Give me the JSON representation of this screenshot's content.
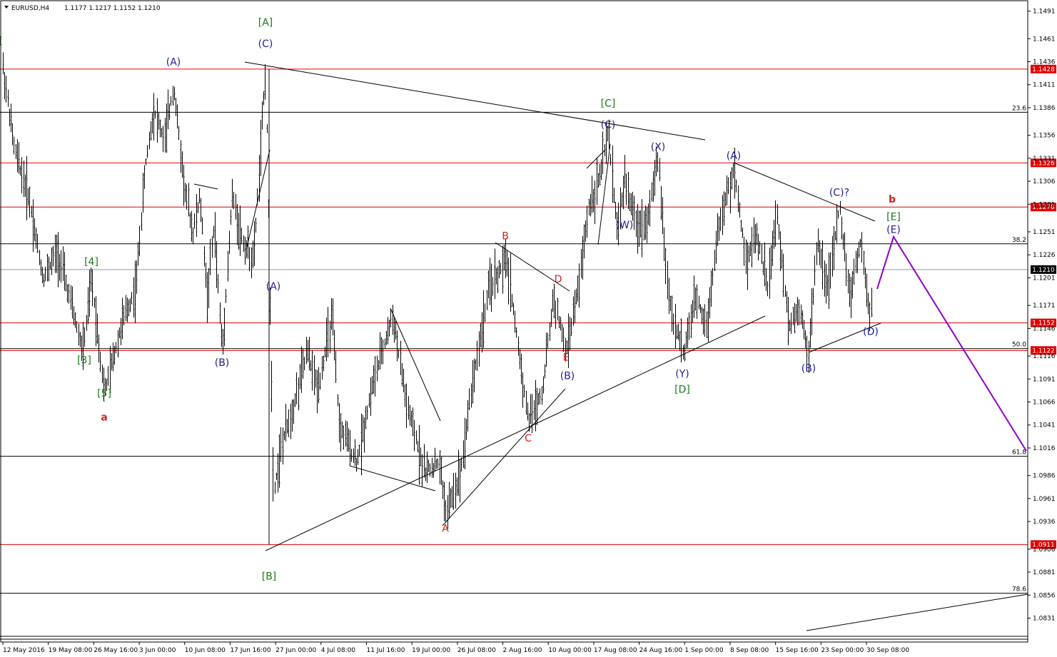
{
  "window": {
    "symbol": "EURUSD,H4",
    "ohlc": "1.1177 1.1217 1.1152 1.1210"
  },
  "colors": {
    "background": "#ffffff",
    "bars": "#000000",
    "resistance": "#e00000",
    "fibo": "#000000",
    "blue_label": "#1f1f8f",
    "green_label": "#1a7a1a",
    "red_label": "#d42020",
    "projection": "#8b00c8",
    "current_price_line": "#7a9cc0"
  },
  "chart_data": {
    "type": "candlestick",
    "instrument": "EURUSD",
    "timeframe": "H4",
    "last_bar": {
      "open": 1.1177,
      "high": 1.1217,
      "low": 1.1152,
      "close": 1.121
    },
    "current_price": "1.1210",
    "ylim": [
      1.0805,
      1.15
    ],
    "price_ticks": [
      "1.1491",
      "1.1461",
      "1.1436",
      "1.1411",
      "1.1386",
      "1.1356",
      "1.1331",
      "1.1306",
      "1.1281",
      "1.1251",
      "1.1226",
      "1.1201",
      "1.1171",
      "1.1146",
      "1.1116",
      "1.1091",
      "1.1066",
      "1.1041",
      "1.1016",
      "1.0986",
      "1.0961",
      "1.0936",
      "1.0906",
      "1.0881",
      "1.0856",
      "1.0831"
    ],
    "time_ticks": [
      "12 May 2016",
      "19 May 08:00",
      "26 May 16:00",
      "3 Jun 00:00",
      "10 Jun 08:00",
      "17 Jun 16:00",
      "27 Jun 00:00",
      "4 Jul 08:00",
      "11 Jul 16:00",
      "19 Jul 00:00",
      "26 Jul 08:00",
      "2 Aug 16:00",
      "10 Aug 00:00",
      "17 Aug 08:00",
      "24 Aug 16:00",
      "1 Sep 00:00",
      "8 Sep 08:00",
      "15 Sep 16:00",
      "23 Sep 00:00",
      "30 Sep 08:00"
    ],
    "horizontal_levels": [
      {
        "label": "1.1428",
        "price": 1.1428,
        "kind": "red"
      },
      {
        "label": "1.1326",
        "price": 1.1326,
        "kind": "red"
      },
      {
        "label": "1.1278",
        "price": 1.1278,
        "kind": "red"
      },
      {
        "label": "1.1152",
        "price": 1.1152,
        "kind": "red"
      },
      {
        "label": "1.1122",
        "price": 1.1122,
        "kind": "red"
      },
      {
        "label": "1.0911",
        "price": 1.0911,
        "kind": "red"
      }
    ],
    "fibo_levels": [
      {
        "label": "23.6",
        "price": 1.1381
      },
      {
        "label": "38.2",
        "price": 1.1238
      },
      {
        "label": "50.0",
        "price": 1.1124
      },
      {
        "label": "61.8",
        "price": 1.1007
      },
      {
        "label": "78.6",
        "price": 1.0858
      }
    ],
    "wave_labels": [
      {
        "text": "[",
        "price": 1.1455,
        "time": 1,
        "color": "green"
      },
      {
        "text": "[A]",
        "price": 1.1475,
        "time": 372,
        "color": "green"
      },
      {
        "text": "(A)",
        "price": 1.1432,
        "time": 243,
        "color": "blue"
      },
      {
        "text": "(C)",
        "price": 1.1452,
        "time": 372,
        "color": "blue"
      },
      {
        "text": "[4]",
        "price": 1.1215,
        "time": 128,
        "color": "green"
      },
      {
        "text": "[3]",
        "price": 1.1108,
        "time": 118,
        "color": "green"
      },
      {
        "text": "[5]",
        "price": 1.1072,
        "time": 146,
        "color": "green"
      },
      {
        "text": "a",
        "price": 1.1046,
        "time": 146,
        "color": "red"
      },
      {
        "text": "(B)",
        "price": 1.1105,
        "time": 311,
        "color": "blue"
      },
      {
        "text": "(A)",
        "price": 1.1188,
        "time": 383,
        "color": "blue"
      },
      {
        "text": "[B]",
        "price": 1.0873,
        "time": 377,
        "color": "green"
      },
      {
        "text": "B",
        "price": 1.1243,
        "time": 708,
        "color": "red"
      },
      {
        "text": "D",
        "price": 1.1196,
        "time": 782,
        "color": "red"
      },
      {
        "text": "E",
        "price": 1.1111,
        "time": 793,
        "color": "red"
      },
      {
        "text": "(B)",
        "price": 1.1091,
        "time": 795,
        "color": "blue"
      },
      {
        "text": "C",
        "price": 1.1023,
        "time": 740,
        "color": "red"
      },
      {
        "text": "A",
        "price": 1.0925,
        "time": 624,
        "color": "red"
      },
      {
        "text": "[C]",
        "price": 1.1387,
        "time": 852,
        "color": "green"
      },
      {
        "text": "(C)",
        "price": 1.1364,
        "time": 852,
        "color": "blue"
      },
      {
        "text": "(X)",
        "price": 1.134,
        "time": 922,
        "color": "blue"
      },
      {
        "text": "(W)",
        "price": 1.1255,
        "time": 875,
        "color": "blue"
      },
      {
        "text": "(Y)",
        "price": 1.1093,
        "time": 956,
        "color": "blue"
      },
      {
        "text": "[D]",
        "price": 1.1076,
        "time": 956,
        "color": "green"
      },
      {
        "text": "(A)",
        "price": 1.133,
        "time": 1028,
        "color": "blue"
      },
      {
        "text": "(C)?",
        "price": 1.129,
        "time": 1176,
        "color": "blue"
      },
      {
        "text": "(B)",
        "price": 1.1099,
        "time": 1133,
        "color": "blue"
      },
      {
        "text": "(D)",
        "price": 1.1139,
        "time": 1220,
        "color": "blue"
      },
      {
        "text": "b",
        "price": 1.1283,
        "time": 1250,
        "color": "red"
      },
      {
        "text": "[E]",
        "price": 1.1264,
        "time": 1252,
        "color": "green"
      },
      {
        "text": "(E)",
        "price": 1.125,
        "time": 1252,
        "color": "blue"
      }
    ]
  }
}
